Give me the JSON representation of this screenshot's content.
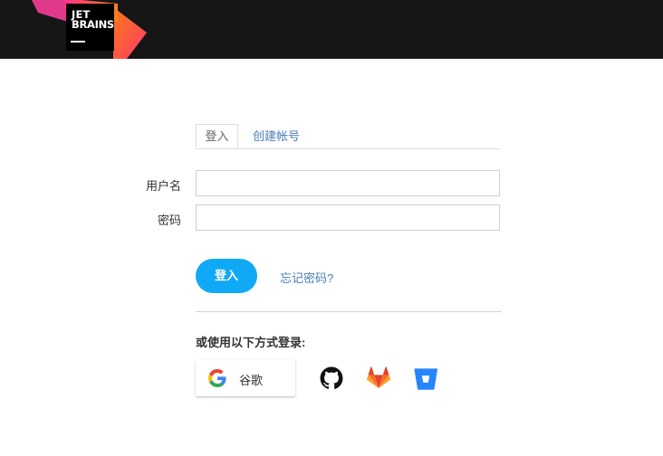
{
  "brand": {
    "line1": "JET",
    "line2": "BRAINS"
  },
  "tabs": {
    "login": "登入",
    "create_account": "创建帐号"
  },
  "form": {
    "username_label": "用户名",
    "password_label": "密码",
    "username_value": "",
    "password_value": ""
  },
  "actions": {
    "login_button": "登入",
    "forgot_password": "忘记密码?"
  },
  "alt_login": {
    "title": "或使用以下方式登录:",
    "google_label": "谷歌",
    "providers": [
      "google-icon",
      "github-icon",
      "gitlab-icon",
      "bitbucket-icon"
    ]
  },
  "colors": {
    "accent": "#10a9f5",
    "link": "#4a7db8",
    "header_bg": "#161616"
  }
}
